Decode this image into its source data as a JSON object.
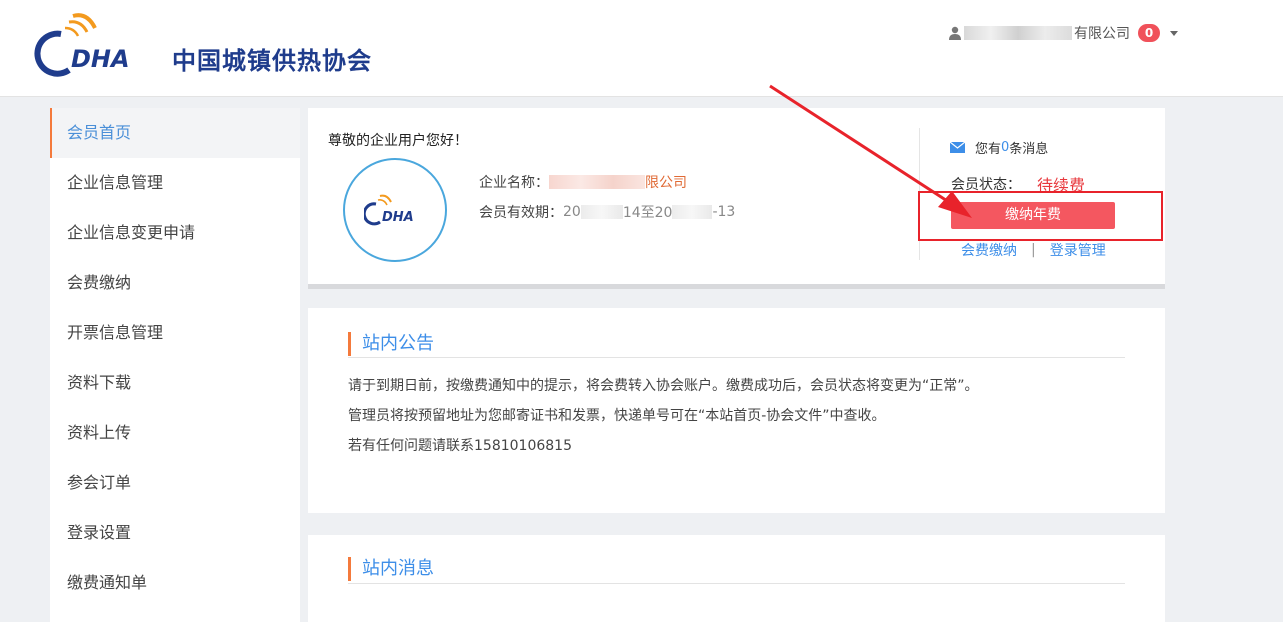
{
  "header": {
    "logo_text": "DHA",
    "org_name": "中国城镇供热协会",
    "user_suffix": "有限公司",
    "notification_count": "0"
  },
  "sidebar": {
    "items": [
      {
        "label": "会员首页"
      },
      {
        "label": "企业信息管理"
      },
      {
        "label": "企业信息变更申请"
      },
      {
        "label": "会费缴纳"
      },
      {
        "label": "开票信息管理"
      },
      {
        "label": "资料下载"
      },
      {
        "label": "资料上传"
      },
      {
        "label": "参会订单"
      },
      {
        "label": "登录设置"
      },
      {
        "label": "缴费通知单"
      }
    ]
  },
  "profile": {
    "greeting": "尊敬的企业用户您好！",
    "company_label": "企业名称：",
    "company_value_suffix": "限公司",
    "validity_label": "会员有效期：",
    "validity_part1": "20",
    "validity_part2": "14至20",
    "validity_part3": "-13"
  },
  "status_panel": {
    "msg_prefix": "您有",
    "msg_count": "0",
    "msg_suffix": "条消息",
    "status_label": "会员状态：",
    "status_value": "待续费",
    "pay_button": "缴纳年费",
    "link_fee": "会费缴纳",
    "link_login": "登录管理",
    "separator": "|"
  },
  "notice": {
    "title": "站内公告",
    "lines": [
      "请于到期日前，按缴费通知中的提示，将会费转入协会账户。缴费成功后，会员状态将变更为“正常”。",
      "管理员将按预留地址为您邮寄证书和发票，快递单号可在“本站首页-协会文件”中查收。",
      "若有任何问题请联系15810106815"
    ]
  },
  "messages": {
    "title": "站内消息"
  },
  "colors": {
    "accent_blue": "#3d8ee8",
    "accent_orange": "#f47a3c",
    "danger": "#e8383d",
    "button": "#f45760"
  }
}
